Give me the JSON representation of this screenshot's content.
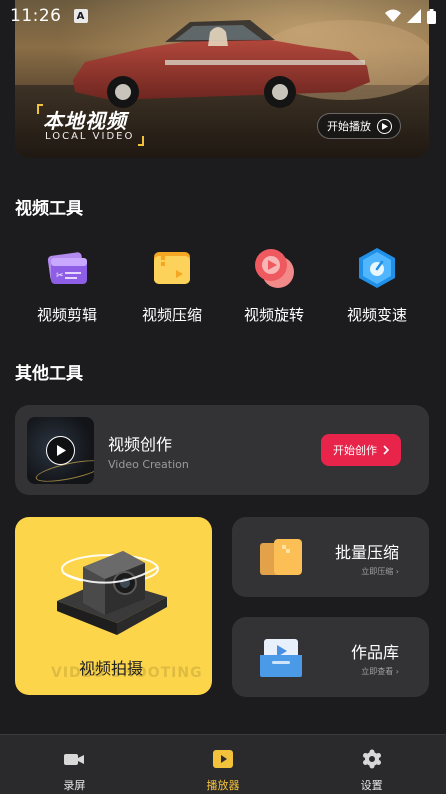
{
  "status_bar": {
    "time": "11:26",
    "notification_letter": "A"
  },
  "banner": {
    "title_cn": "本地视频",
    "title_en": "LOCAL VIDEO",
    "play_label": "开始播放"
  },
  "video_tools": {
    "title": "视频工具",
    "items": [
      {
        "label": "视频剪辑",
        "icon": "clapperboard-icon"
      },
      {
        "label": "视频压缩",
        "icon": "compress-folder-icon"
      },
      {
        "label": "视频旋转",
        "icon": "rotate-play-icon"
      },
      {
        "label": "视频变速",
        "icon": "speed-hexagon-icon"
      }
    ]
  },
  "other_tools": {
    "title": "其他工具",
    "create": {
      "title": "视频创作",
      "subtitle": "Video Creation",
      "button_label": "开始创作"
    },
    "shoot": {
      "label": "视频拍摄",
      "watermark": "VIDEO SHOOTING"
    },
    "batch": {
      "title": "批量压缩",
      "link": "立即压缩"
    },
    "library": {
      "title": "作品库",
      "link": "立即查看"
    }
  },
  "bottom_nav": {
    "items": [
      {
        "label": "录屏",
        "active": false
      },
      {
        "label": "播放器",
        "active": true
      },
      {
        "label": "设置",
        "active": false
      }
    ]
  },
  "colors": {
    "accent": "#f3c23d",
    "create_button": "#e8244a",
    "card": "#333335",
    "background": "#1c1c1e"
  }
}
